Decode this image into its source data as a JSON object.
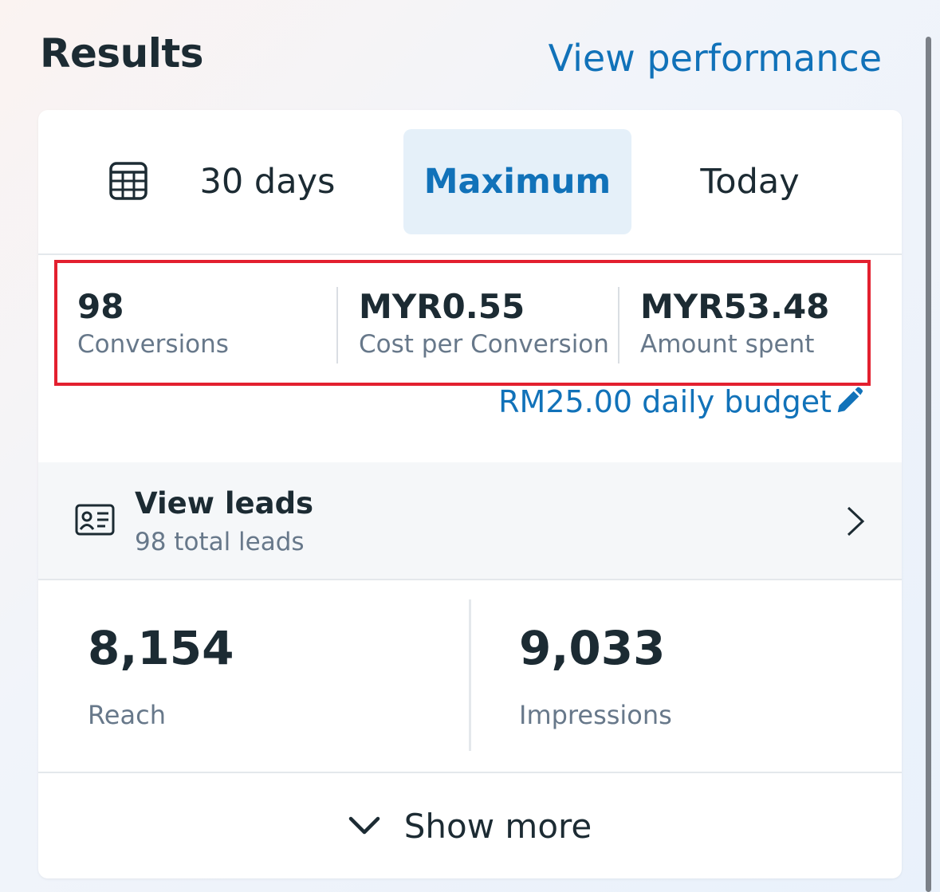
{
  "header": {
    "title": "Results",
    "view_performance_label": "View performance"
  },
  "date_tabs": {
    "calendar_icon": "calendar-icon",
    "items": [
      {
        "label": "30 days",
        "selected": false
      },
      {
        "label": "Maximum",
        "selected": true
      },
      {
        "label": "Today",
        "selected": false
      }
    ]
  },
  "metrics": [
    {
      "value": "98",
      "label": "Conversions"
    },
    {
      "value": "MYR0.55",
      "label": "Cost per Conversion"
    },
    {
      "value": "MYR53.48",
      "label": "Amount spent"
    }
  ],
  "budget": {
    "label": "RM25.00 daily budget",
    "icon": "pencil-icon"
  },
  "leads": {
    "title": "View leads",
    "subtitle": "98 total leads",
    "icon": "contact-card-icon"
  },
  "stats": [
    {
      "value": "8,154",
      "label": "Reach"
    },
    {
      "value": "9,033",
      "label": "Impressions"
    }
  ],
  "show_more": {
    "label": "Show more",
    "icon": "chevron-down-icon"
  },
  "colors": {
    "accent": "#1172b9",
    "text_primary": "#1c2b33",
    "text_secondary": "#67788a",
    "selected_tab_bg": "#e5f0f9",
    "highlight_border": "#e3202f"
  }
}
